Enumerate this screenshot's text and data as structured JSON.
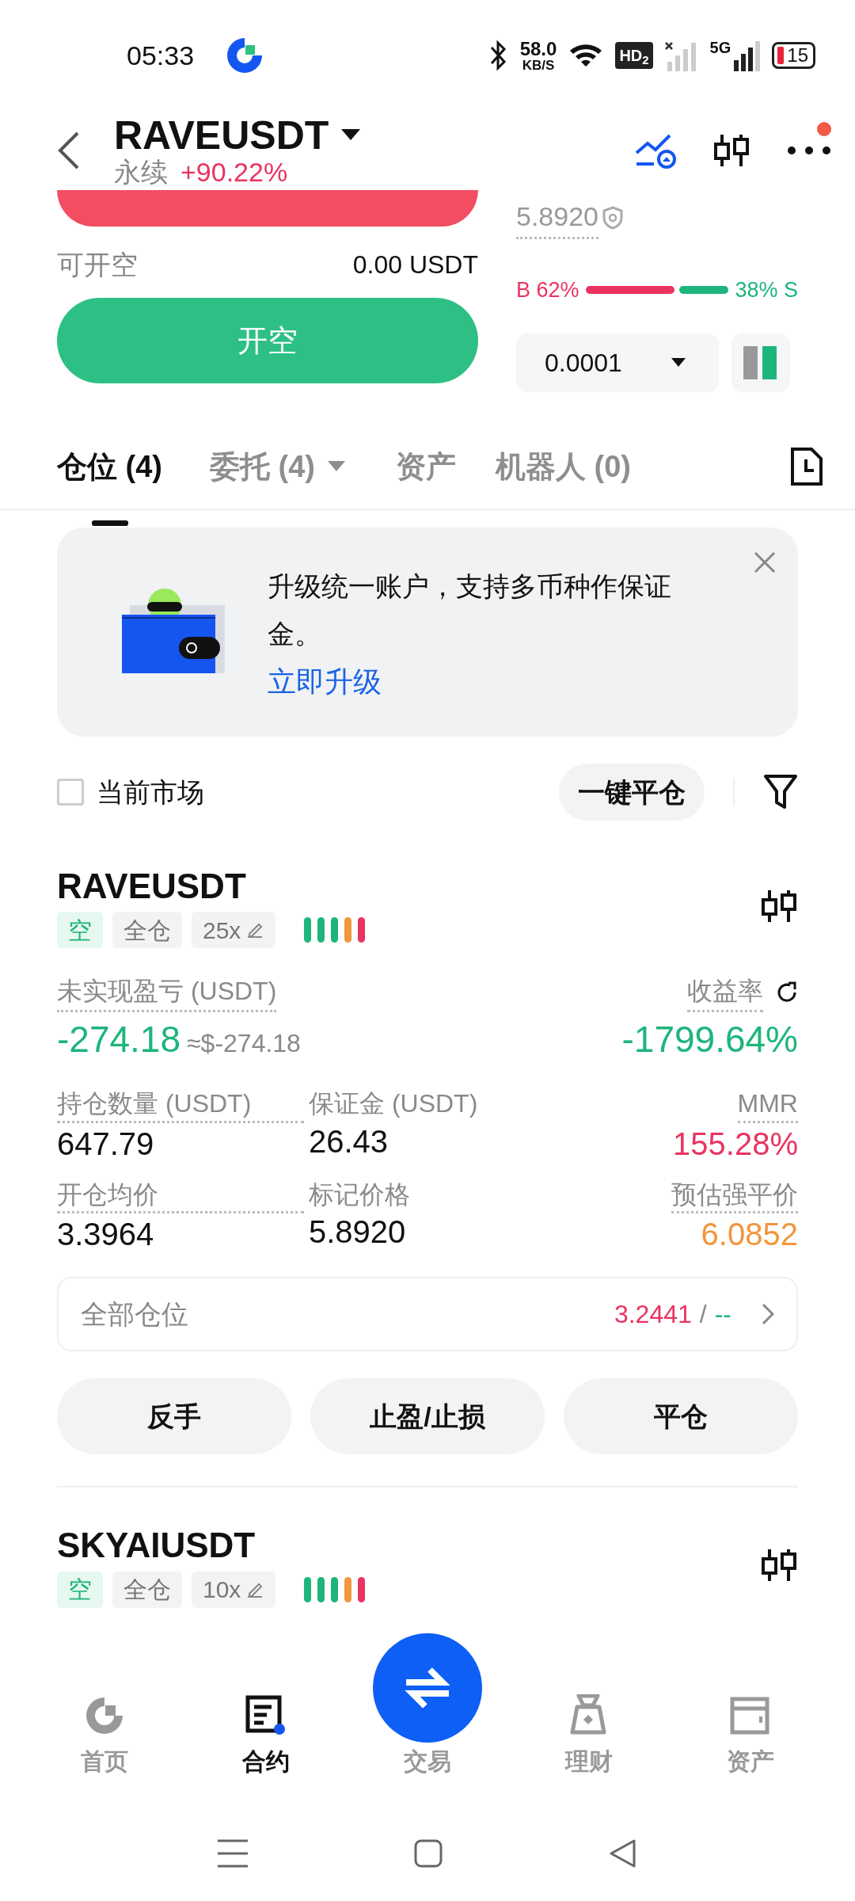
{
  "status_bar": {
    "time": "05:33",
    "net_speed": "58.0",
    "net_speed_unit": "KB/S",
    "hd_label": "HD$_{2}$",
    "network": "5G",
    "battery": "15"
  },
  "header": {
    "symbol": "RAVEUSDT",
    "contract_type": "永续",
    "change": "+90.22%",
    "menu_badge": true
  },
  "order_panel": {
    "available_label": "可开空",
    "available_value": "0.00 USDT",
    "sell_button": "开空",
    "mark_price": "5.8920",
    "ratio": {
      "buy_label": "B 62%",
      "sell_label": "38% S",
      "level": 0.62
    },
    "precision": "0.0001"
  },
  "tabs": [
    {
      "label": "仓位 (4)",
      "selected": true,
      "dropdown": false
    },
    {
      "label": "委托 (4)",
      "selected": false,
      "dropdown": true
    },
    {
      "label": "资产",
      "selected": false,
      "dropdown": false
    },
    {
      "label": "机器人 (0)",
      "selected": false,
      "dropdown": false
    }
  ],
  "banner": {
    "text": "升级统一账户，支持多币种作保证金。",
    "link": "立即升级"
  },
  "filter": {
    "label": "当前市场",
    "checked": false,
    "close_all": "一键平仓"
  },
  "positions": [
    {
      "symbol": "RAVEUSDT",
      "side": "空",
      "margin_mode": "全仓",
      "leverage": "25x",
      "pnl": {
        "label": "未实现盈亏 (USDT)",
        "value": "-274.18",
        "approx": "≈$-274.18",
        "roi_label": "收益率",
        "roi": "-1799.64%",
        "color": "#1db57c"
      },
      "metrics": [
        {
          "label": "持仓数量 (USDT)",
          "value": "647.79",
          "dotted": true,
          "color": "#111111"
        },
        {
          "label": "保证金 (USDT)",
          "value": "26.43",
          "dotted": false,
          "color": "#111111"
        },
        {
          "label": "MMR",
          "value": "155.28%",
          "dotted": true,
          "color": "#ea3360"
        },
        {
          "label": "开仓均价",
          "value": "3.3964",
          "dotted": true,
          "color": "#111111"
        },
        {
          "label": "标记价格",
          "value": "5.8920",
          "dotted": false,
          "color": "#111111"
        },
        {
          "label": "预估强平价",
          "value": "6.0852",
          "dotted": true,
          "color": "#f2953c"
        }
      ],
      "all_positions": {
        "label": "全部仓位",
        "take_profit": "3.2441",
        "separator": "/",
        "stop_loss": "--"
      },
      "actions": [
        "反手",
        "止盈/止损",
        "平仓"
      ]
    },
    {
      "symbol": "SKYAIUSDT",
      "side": "空",
      "margin_mode": "全仓",
      "leverage": "10x"
    }
  ],
  "bottom_nav": [
    {
      "kind": "home",
      "label": "首页",
      "selected": false
    },
    {
      "kind": "contract",
      "label": "合约",
      "selected": true
    },
    {
      "kind": "trade",
      "label": "交易",
      "selected": false
    },
    {
      "kind": "earn",
      "label": "理财",
      "selected": false
    },
    {
      "kind": "assets",
      "label": "资产",
      "selected": false
    }
  ]
}
